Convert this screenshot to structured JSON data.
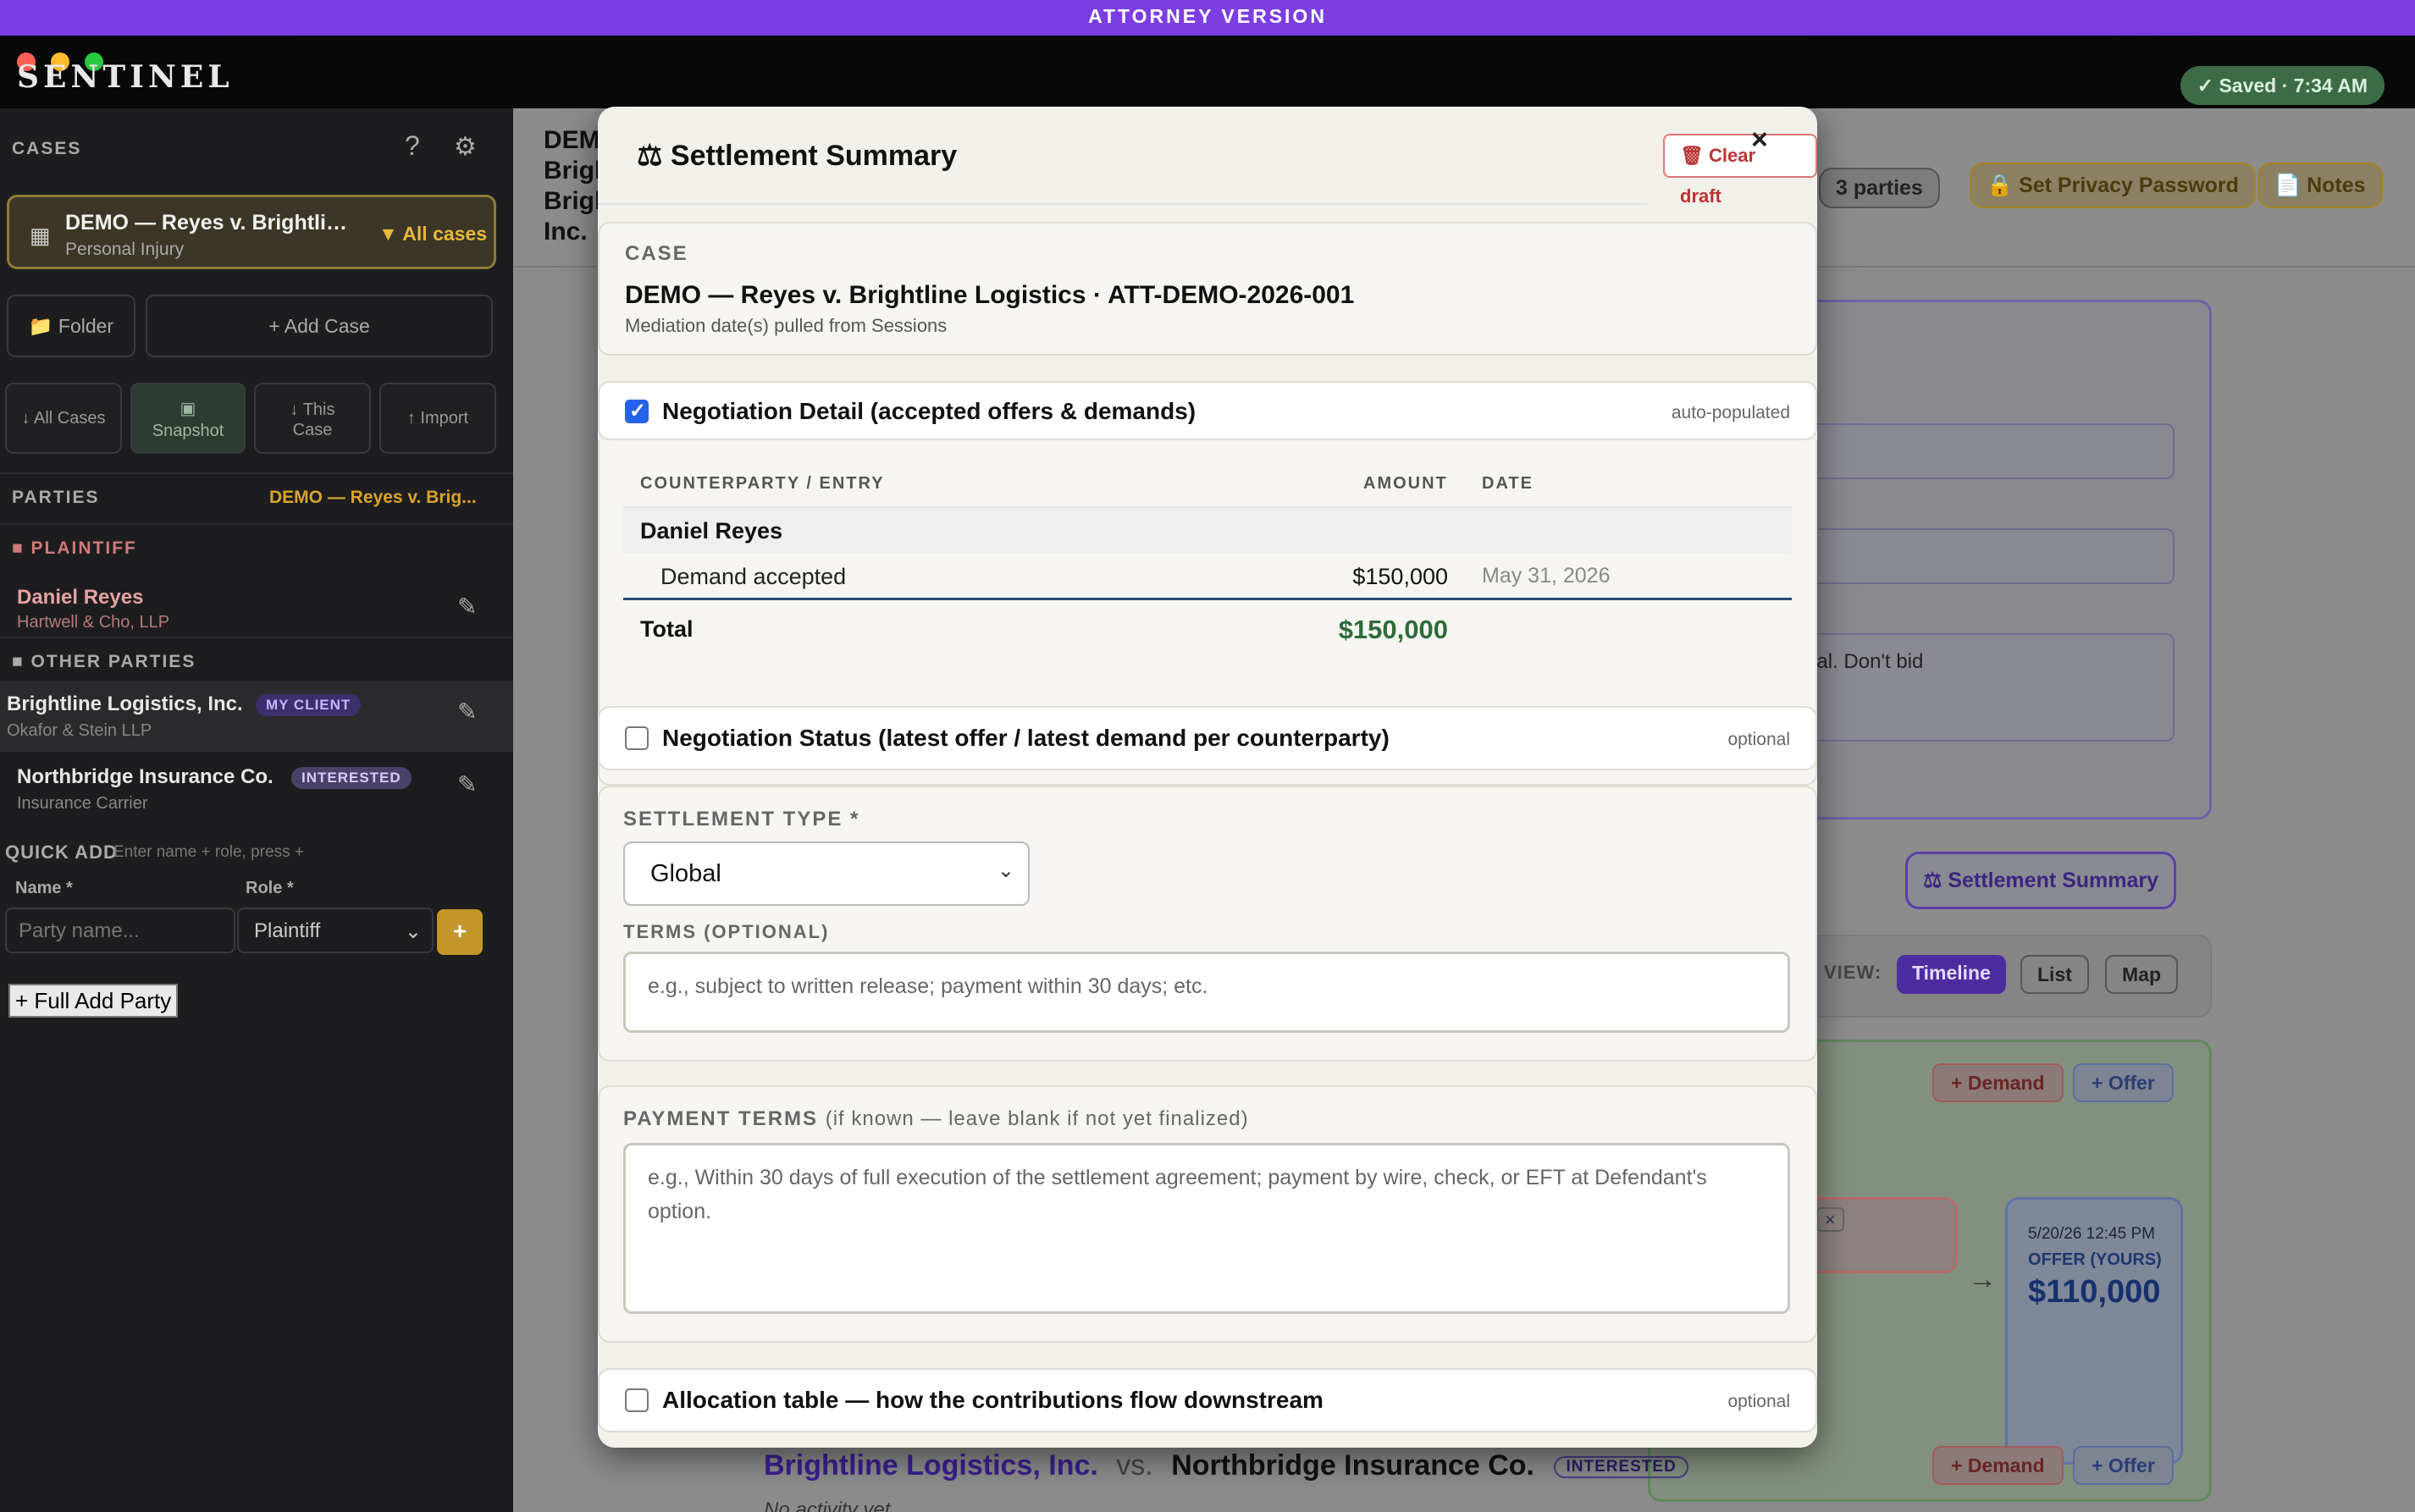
{
  "banner": "ATTORNEY VERSION",
  "app": {
    "logo": "SENTINEL",
    "saved": "✓ Saved · 7:34 AM"
  },
  "sidebar": {
    "cases_header": "CASES",
    "case_card": {
      "name": "DEMO — Reyes v. Brightlin...",
      "type": "Personal Injury",
      "all_cases": "▼ All cases"
    },
    "buttons": {
      "folder": "📁 Folder",
      "add_case": "+ Add Case"
    },
    "actions": {
      "all_cases": "↓ All Cases",
      "snapshot": "Snapshot",
      "this_case": "↓ This Case",
      "import": "↑ Import"
    },
    "parties_header": "PARTIES",
    "parties_case": "DEMO — Reyes v. Brig...",
    "plaintiff_label": "PLAINTIFF",
    "plaintiff": {
      "name": "Daniel Reyes",
      "firm": "Hartwell & Cho, LLP"
    },
    "other_label": "OTHER PARTIES",
    "others": [
      {
        "name": "Brightline Logistics, Inc.",
        "firm": "Okafor & Stein LLP",
        "badge": "MY CLIENT"
      },
      {
        "name": "Northbridge Insurance Co.",
        "firm": "Insurance Carrier",
        "badge": "INTERESTED"
      }
    ],
    "quick_add": {
      "label": "QUICK ADD",
      "hint": "Enter name + role, press +",
      "name_label": "Name *",
      "role_label": "Role *",
      "name_placeholder": "Party name...",
      "role_value": "Plaintiff",
      "plus": "+"
    },
    "full_add": "+ Full Add Party"
  },
  "main": {
    "title_lines": [
      "DEM",
      "Brigh",
      "Brigh",
      "Inc."
    ],
    "chips": {
      "parties": "3 parties",
      "privacy": "🔒 Set Privacy Password",
      "notes": "📄 Notes"
    },
    "textarea_fragment": "xposure is real. Don't bid",
    "settlement_btn": "⚖ Settlement Summary",
    "view_label": "VIEW:",
    "views": [
      "Timeline",
      "List",
      "Map"
    ],
    "demand": "+ Demand",
    "offer": "+ Offer",
    "offer_card": {
      "when": "5/20/26 12:45 PM",
      "kind": "OFFER (YOURS)",
      "amount": "$110,000"
    },
    "vs_row": {
      "left": "Brightline Logistics, Inc.",
      "vs": "vs.",
      "right": "Northbridge Insurance Co.",
      "badge": "INTERESTED",
      "no_activity": "No activity yet"
    }
  },
  "modal": {
    "title": "⚖ Settlement Summary",
    "clear_draft": "🗑 Clear draft",
    "close": "×",
    "case": {
      "label": "CASE",
      "line": "DEMO — Reyes v. Brightline Logistics · ATT-DEMO-2026-001",
      "note": "Mediation date(s) pulled from Sessions"
    },
    "negotiation_detail": {
      "label": "Negotiation Detail (accepted offers & demands)",
      "tag": "auto-populated",
      "checked": true,
      "headers": [
        "COUNTERPARTY / ENTRY",
        "AMOUNT",
        "DATE"
      ],
      "counterparty": "Daniel Reyes",
      "entry": {
        "label": "Demand accepted",
        "amount": "$150,000",
        "date": "May 31, 2026"
      },
      "total_label": "Total",
      "total_amount": "$150,000"
    },
    "negotiation_status": {
      "label": "Negotiation Status (latest offer / latest demand per counterparty)",
      "tag": "optional",
      "checked": false
    },
    "settlement_type": {
      "label": "SETTLEMENT TYPE *",
      "value": "Global"
    },
    "terms": {
      "label": "TERMS (OPTIONAL)",
      "placeholder": "e.g., subject to written release; payment within 30 days; etc."
    },
    "payment_terms": {
      "label": "PAYMENT TERMS",
      "hint": "(if known — leave blank if not yet finalized)",
      "placeholder": "e.g., Within 30 days of full execution of the settlement agreement; payment by wire, check, or EFT at Defendant's option."
    },
    "allocation": {
      "label": "Allocation table — how the contributions flow downstream",
      "tag": "optional",
      "checked": false
    }
  },
  "colors": {
    "accent_purple": "#7a3ee6",
    "gold": "#c2962a",
    "total_green": "#2e6b3a",
    "checkbox_blue": "#2563eb"
  }
}
